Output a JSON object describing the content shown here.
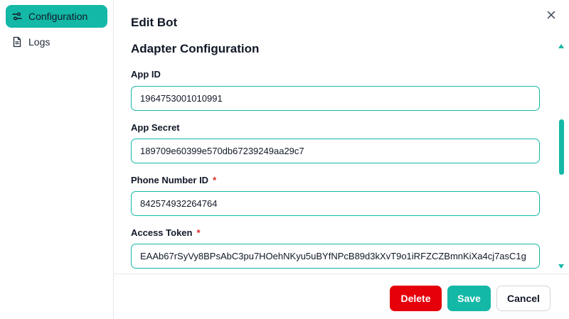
{
  "sidebar": {
    "items": [
      {
        "label": "Configuration",
        "icon": "sliders-icon",
        "active": true
      },
      {
        "label": "Logs",
        "icon": "document-icon",
        "active": false
      }
    ]
  },
  "dialog": {
    "title": "Edit Bot",
    "section_title": "Adapter Configuration",
    "close_icon": "close-icon"
  },
  "fields": {
    "app_id": {
      "label": "App ID",
      "value": "1964753001010991",
      "required": false
    },
    "app_secret": {
      "label": "App Secret",
      "value": "189709e60399e570db67239249aa29c7",
      "required": false
    },
    "phone_number_id": {
      "label": "Phone Number ID",
      "value": "842574932264764",
      "required": true
    },
    "access_token": {
      "label": "Access Token",
      "value": "EAAb67rSyVy8BPsAbC3pu7HOehNKyu5uBYfNPcB89d3kXvT9o1iRFZCZBmnKiXa4cj7asC1g",
      "required": true
    },
    "required_marker": "*"
  },
  "footer": {
    "delete_label": "Delete",
    "save_label": "Save",
    "cancel_label": "Cancel"
  },
  "colors": {
    "accent": "#14b8a6",
    "danger": "#e5000a",
    "required": "#dc2626"
  }
}
